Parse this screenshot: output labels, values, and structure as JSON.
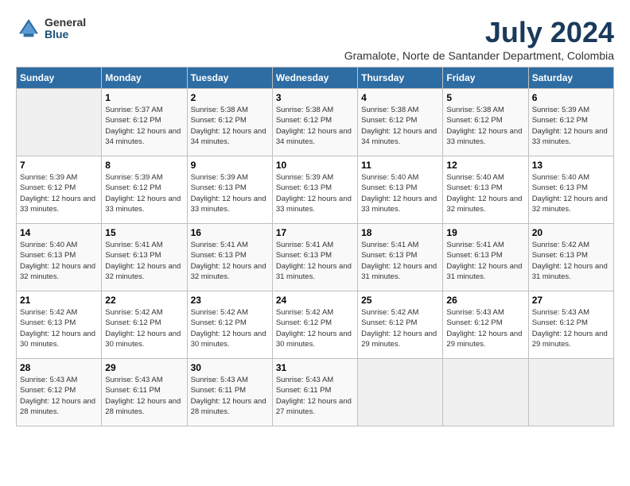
{
  "logo": {
    "general": "General",
    "blue": "Blue"
  },
  "title": {
    "month_year": "July 2024",
    "location": "Gramalote, Norte de Santander Department, Colombia"
  },
  "days_of_week": [
    "Sunday",
    "Monday",
    "Tuesday",
    "Wednesday",
    "Thursday",
    "Friday",
    "Saturday"
  ],
  "weeks": [
    [
      {
        "day": "",
        "sunrise": "",
        "sunset": "",
        "daylight": "",
        "empty": true
      },
      {
        "day": "1",
        "sunrise": "Sunrise: 5:37 AM",
        "sunset": "Sunset: 6:12 PM",
        "daylight": "Daylight: 12 hours and 34 minutes."
      },
      {
        "day": "2",
        "sunrise": "Sunrise: 5:38 AM",
        "sunset": "Sunset: 6:12 PM",
        "daylight": "Daylight: 12 hours and 34 minutes."
      },
      {
        "day": "3",
        "sunrise": "Sunrise: 5:38 AM",
        "sunset": "Sunset: 6:12 PM",
        "daylight": "Daylight: 12 hours and 34 minutes."
      },
      {
        "day": "4",
        "sunrise": "Sunrise: 5:38 AM",
        "sunset": "Sunset: 6:12 PM",
        "daylight": "Daylight: 12 hours and 34 minutes."
      },
      {
        "day": "5",
        "sunrise": "Sunrise: 5:38 AM",
        "sunset": "Sunset: 6:12 PM",
        "daylight": "Daylight: 12 hours and 33 minutes."
      },
      {
        "day": "6",
        "sunrise": "Sunrise: 5:39 AM",
        "sunset": "Sunset: 6:12 PM",
        "daylight": "Daylight: 12 hours and 33 minutes."
      }
    ],
    [
      {
        "day": "7",
        "sunrise": "Sunrise: 5:39 AM",
        "sunset": "Sunset: 6:12 PM",
        "daylight": "Daylight: 12 hours and 33 minutes."
      },
      {
        "day": "8",
        "sunrise": "Sunrise: 5:39 AM",
        "sunset": "Sunset: 6:12 PM",
        "daylight": "Daylight: 12 hours and 33 minutes."
      },
      {
        "day": "9",
        "sunrise": "Sunrise: 5:39 AM",
        "sunset": "Sunset: 6:13 PM",
        "daylight": "Daylight: 12 hours and 33 minutes."
      },
      {
        "day": "10",
        "sunrise": "Sunrise: 5:39 AM",
        "sunset": "Sunset: 6:13 PM",
        "daylight": "Daylight: 12 hours and 33 minutes."
      },
      {
        "day": "11",
        "sunrise": "Sunrise: 5:40 AM",
        "sunset": "Sunset: 6:13 PM",
        "daylight": "Daylight: 12 hours and 33 minutes."
      },
      {
        "day": "12",
        "sunrise": "Sunrise: 5:40 AM",
        "sunset": "Sunset: 6:13 PM",
        "daylight": "Daylight: 12 hours and 32 minutes."
      },
      {
        "day": "13",
        "sunrise": "Sunrise: 5:40 AM",
        "sunset": "Sunset: 6:13 PM",
        "daylight": "Daylight: 12 hours and 32 minutes."
      }
    ],
    [
      {
        "day": "14",
        "sunrise": "Sunrise: 5:40 AM",
        "sunset": "Sunset: 6:13 PM",
        "daylight": "Daylight: 12 hours and 32 minutes."
      },
      {
        "day": "15",
        "sunrise": "Sunrise: 5:41 AM",
        "sunset": "Sunset: 6:13 PM",
        "daylight": "Daylight: 12 hours and 32 minutes."
      },
      {
        "day": "16",
        "sunrise": "Sunrise: 5:41 AM",
        "sunset": "Sunset: 6:13 PM",
        "daylight": "Daylight: 12 hours and 32 minutes."
      },
      {
        "day": "17",
        "sunrise": "Sunrise: 5:41 AM",
        "sunset": "Sunset: 6:13 PM",
        "daylight": "Daylight: 12 hours and 31 minutes."
      },
      {
        "day": "18",
        "sunrise": "Sunrise: 5:41 AM",
        "sunset": "Sunset: 6:13 PM",
        "daylight": "Daylight: 12 hours and 31 minutes."
      },
      {
        "day": "19",
        "sunrise": "Sunrise: 5:41 AM",
        "sunset": "Sunset: 6:13 PM",
        "daylight": "Daylight: 12 hours and 31 minutes."
      },
      {
        "day": "20",
        "sunrise": "Sunrise: 5:42 AM",
        "sunset": "Sunset: 6:13 PM",
        "daylight": "Daylight: 12 hours and 31 minutes."
      }
    ],
    [
      {
        "day": "21",
        "sunrise": "Sunrise: 5:42 AM",
        "sunset": "Sunset: 6:13 PM",
        "daylight": "Daylight: 12 hours and 30 minutes."
      },
      {
        "day": "22",
        "sunrise": "Sunrise: 5:42 AM",
        "sunset": "Sunset: 6:12 PM",
        "daylight": "Daylight: 12 hours and 30 minutes."
      },
      {
        "day": "23",
        "sunrise": "Sunrise: 5:42 AM",
        "sunset": "Sunset: 6:12 PM",
        "daylight": "Daylight: 12 hours and 30 minutes."
      },
      {
        "day": "24",
        "sunrise": "Sunrise: 5:42 AM",
        "sunset": "Sunset: 6:12 PM",
        "daylight": "Daylight: 12 hours and 30 minutes."
      },
      {
        "day": "25",
        "sunrise": "Sunrise: 5:42 AM",
        "sunset": "Sunset: 6:12 PM",
        "daylight": "Daylight: 12 hours and 29 minutes."
      },
      {
        "day": "26",
        "sunrise": "Sunrise: 5:43 AM",
        "sunset": "Sunset: 6:12 PM",
        "daylight": "Daylight: 12 hours and 29 minutes."
      },
      {
        "day": "27",
        "sunrise": "Sunrise: 5:43 AM",
        "sunset": "Sunset: 6:12 PM",
        "daylight": "Daylight: 12 hours and 29 minutes."
      }
    ],
    [
      {
        "day": "28",
        "sunrise": "Sunrise: 5:43 AM",
        "sunset": "Sunset: 6:12 PM",
        "daylight": "Daylight: 12 hours and 28 minutes."
      },
      {
        "day": "29",
        "sunrise": "Sunrise: 5:43 AM",
        "sunset": "Sunset: 6:11 PM",
        "daylight": "Daylight: 12 hours and 28 minutes."
      },
      {
        "day": "30",
        "sunrise": "Sunrise: 5:43 AM",
        "sunset": "Sunset: 6:11 PM",
        "daylight": "Daylight: 12 hours and 28 minutes."
      },
      {
        "day": "31",
        "sunrise": "Sunrise: 5:43 AM",
        "sunset": "Sunset: 6:11 PM",
        "daylight": "Daylight: 12 hours and 27 minutes."
      },
      {
        "day": "",
        "sunrise": "",
        "sunset": "",
        "daylight": "",
        "empty": true
      },
      {
        "day": "",
        "sunrise": "",
        "sunset": "",
        "daylight": "",
        "empty": true
      },
      {
        "day": "",
        "sunrise": "",
        "sunset": "",
        "daylight": "",
        "empty": true
      }
    ]
  ]
}
